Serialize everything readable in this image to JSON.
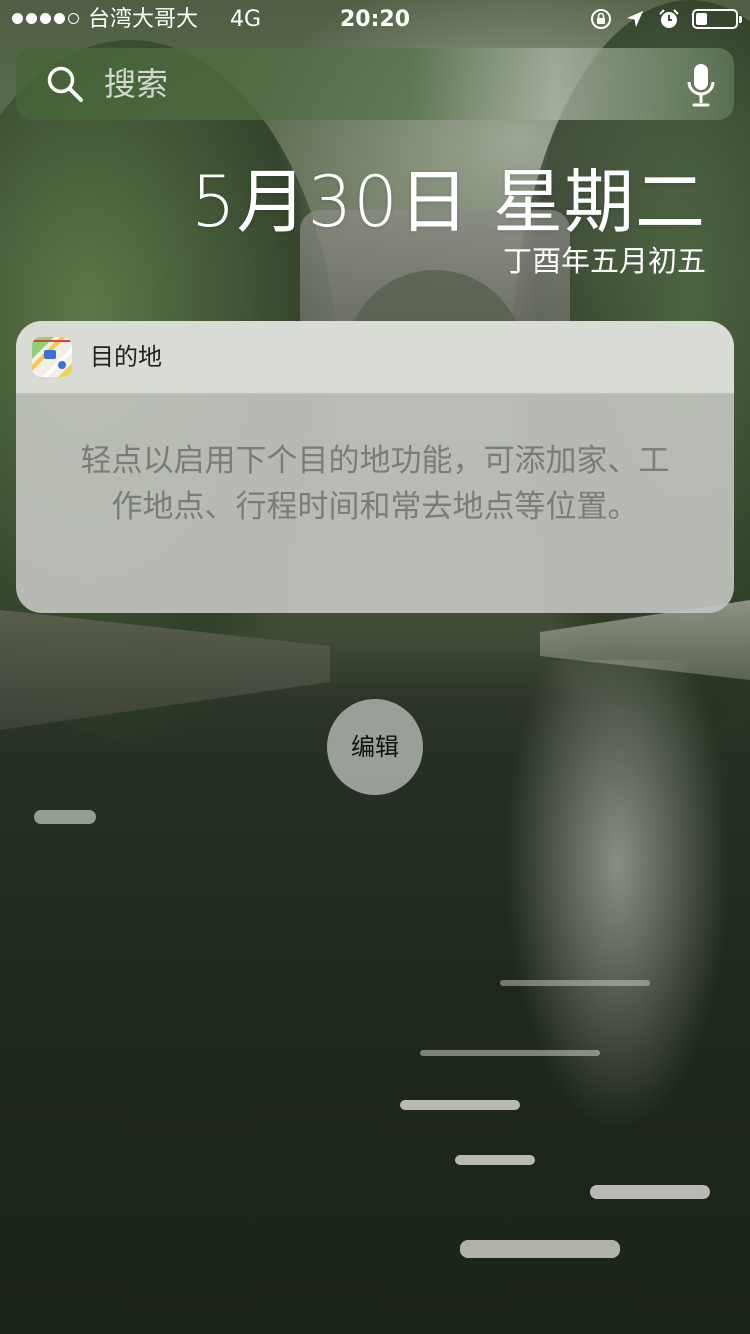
{
  "status_bar": {
    "signal_bars_filled": 4,
    "signal_bars_total": 5,
    "carrier": "台湾大哥大",
    "network": "4G",
    "time": "20:20",
    "icons": [
      "orientation-lock-icon",
      "location-arrow-icon",
      "alarm-icon",
      "battery-icon"
    ],
    "battery_level": 0.3
  },
  "search": {
    "placeholder": "搜索",
    "value": "",
    "icon": "search-icon",
    "mic_icon": "microphone-icon"
  },
  "date": {
    "main": "5月30日 星期二",
    "lunar": "丁酉年五月初五"
  },
  "widget": {
    "app_icon": "maps-app-icon",
    "title": "目的地",
    "message": "轻点以启用下个目的地功能，可添加家、工作地点、行程时间和常去地点等位置。"
  },
  "edit_button": {
    "label": "编辑"
  }
}
